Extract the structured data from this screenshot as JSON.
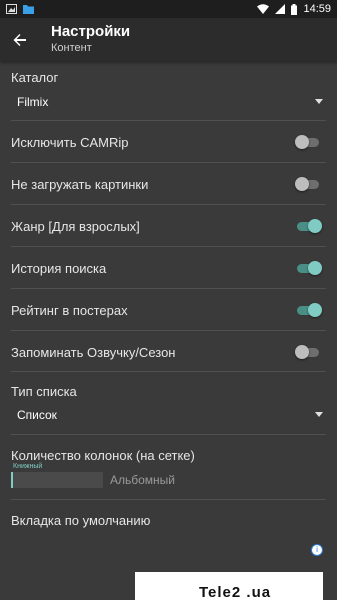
{
  "status_bar": {
    "time": "14:59",
    "icons": [
      "image-icon",
      "folder-icon",
      "wifi-icon",
      "signal-icon",
      "battery-icon"
    ]
  },
  "app_bar": {
    "back_icon": "arrow-left-icon",
    "title": "Настройки",
    "subtitle": "Контент"
  },
  "settings": {
    "catalog_label": "Каталог",
    "catalog_value": "Filmix",
    "exclude_camrip": "Исключить CAMRip",
    "no_images": "Не загружать картинки",
    "genre_adult": "Жанр [Для взрослых]",
    "search_history": "История поиска",
    "poster_rating": "Рейтинг в постерах",
    "remember_voice": "Запоминать Озвучку/Сезон",
    "list_type_label": "Тип списка",
    "list_type_value": "Список",
    "columns_label": "Количество колонок (на сетке)",
    "columns_hint": "Книжный",
    "columns_alt": "Альбомный",
    "default_tab_label": "Вкладка по умолчанию"
  },
  "toggles": {
    "exclude_camrip": false,
    "no_images": false,
    "genre_adult": true,
    "search_history": true,
    "poster_rating": true,
    "remember_voice": false
  },
  "ad": {
    "info_icon": "info-icon",
    "text": "Tele2 .ua"
  },
  "colors": {
    "accent": "#80cbc4",
    "background": "#3a3a3a",
    "app_bar": "#2c2c2c",
    "status_bar": "#1e1e1e"
  }
}
